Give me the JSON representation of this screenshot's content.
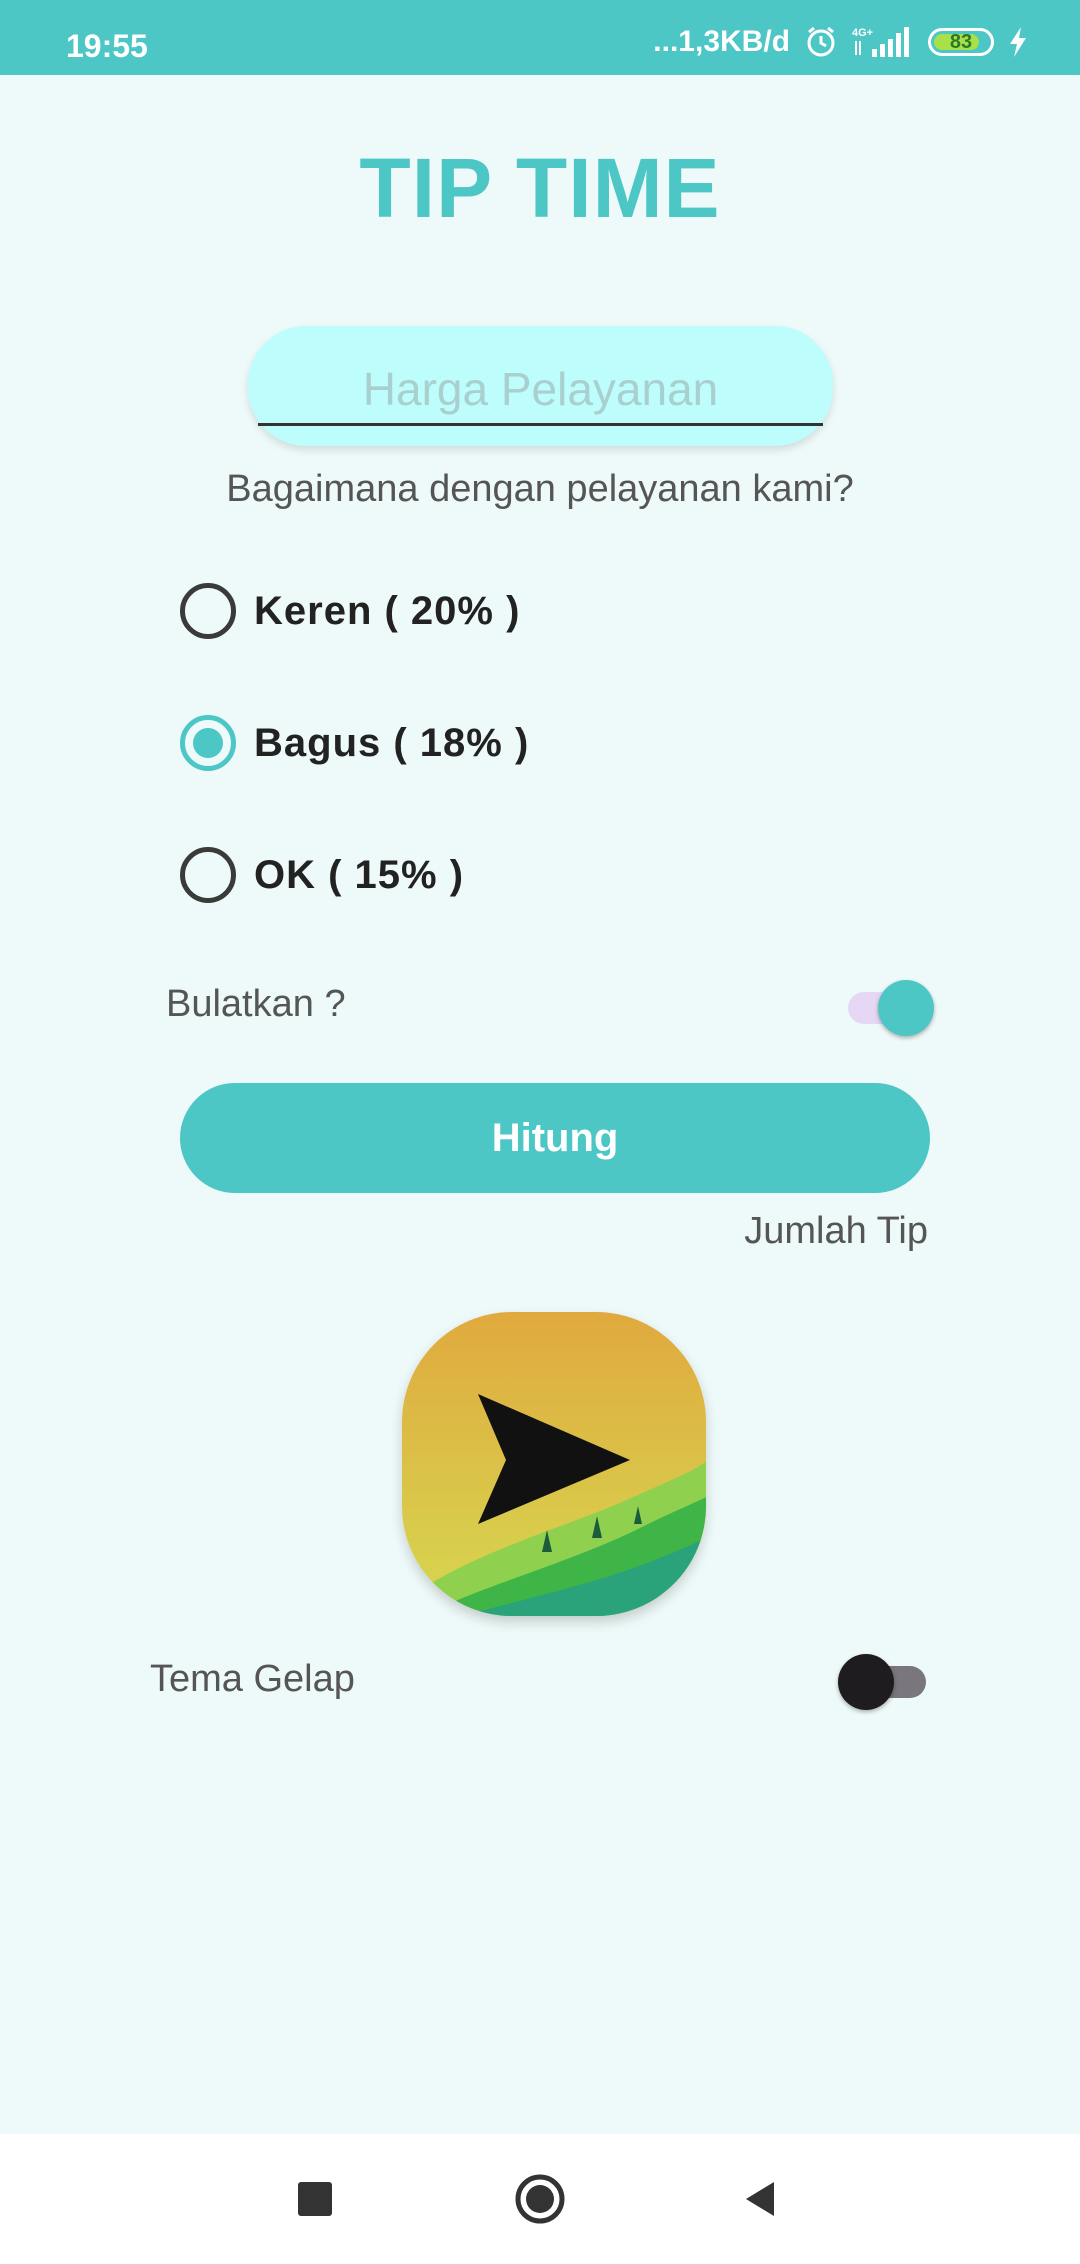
{
  "status_bar": {
    "time": "19:55",
    "network_speed": "...1,3KB/d",
    "network_type": "4G+",
    "battery_level": "83",
    "battery_fraction": 0.83,
    "background_color": "#4dc6c6",
    "icons": [
      "alarm-icon",
      "signal-icon",
      "battery-icon",
      "charging-icon"
    ]
  },
  "app": {
    "title": "TIP TIME",
    "accent_color": "#4dc6c6"
  },
  "price_input": {
    "placeholder": "Harga Pelayanan",
    "value": ""
  },
  "service_question": "Bagaimana dengan pelayanan kami?",
  "tip_options": [
    {
      "label": "Keren ( 20% )",
      "checked": false
    },
    {
      "label": "Bagus ( 18% )",
      "checked": true
    },
    {
      "label": "OK ( 15% )",
      "checked": false
    }
  ],
  "round_up": {
    "label": "Bulatkan ?",
    "on": true
  },
  "calculate_button": {
    "label": "Hitung"
  },
  "tip_result": {
    "label": "Jumlah Tip"
  },
  "logo": {
    "icon": "send-arrow-icon"
  },
  "dark_theme": {
    "label": "Tema Gelap",
    "on": false
  },
  "nav_bar": {
    "icons": [
      "recents-square-icon",
      "home-circle-icon",
      "back-triangle-icon"
    ]
  }
}
